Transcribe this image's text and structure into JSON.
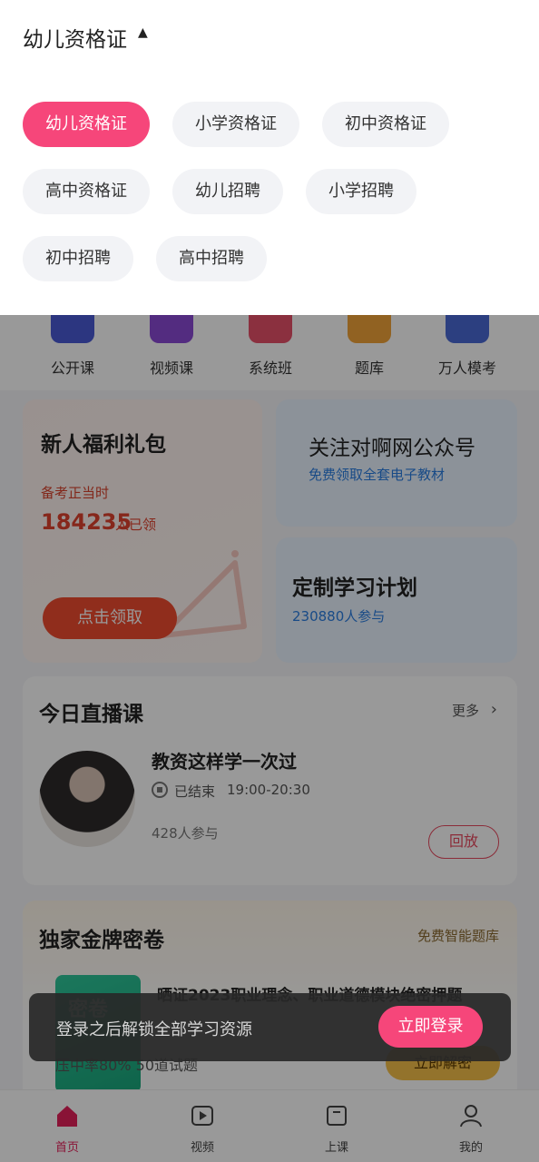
{
  "quick_nav": [
    {
      "label": "公开课",
      "icon": "open-class-icon",
      "color": "#4a5bd6"
    },
    {
      "label": "视频课",
      "icon": "video-class-icon",
      "color": "#8a4ad6"
    },
    {
      "label": "系统班",
      "icon": "system-class-icon",
      "color": "#e8506a"
    },
    {
      "label": "题库",
      "icon": "question-bank-icon",
      "color": "#f2a33a"
    },
    {
      "label": "万人模考",
      "icon": "mock-exam-icon",
      "color": "#4a6ad6"
    }
  ],
  "gift_card": {
    "title": "新人福利礼包",
    "subtitle": "备考正当时",
    "count": "184235",
    "count_unit": "人已领",
    "button": "点击领取"
  },
  "follow_card": {
    "title": "关注对啊网公众号",
    "subtitle": "免费领取全套电子教材"
  },
  "plan_card": {
    "title": "定制学习计划",
    "subtitle": "230880人参与"
  },
  "live": {
    "heading": "今日直播课",
    "more": "更多",
    "course_title": "教资这样学一次过",
    "status": "已结束",
    "time": "19:00-20:30",
    "participants": "428人参与",
    "replay": "回放"
  },
  "paper": {
    "heading": "独家金牌密卷",
    "link": "免费智能题库",
    "book_label": "密卷",
    "title": "晒证2023职业理念、职业道德模块绝密押题",
    "subtitle": "压中率80% 50道试题",
    "unlock": "立即解密"
  },
  "tabbar": [
    {
      "label": "首页",
      "icon": "home-icon",
      "active": true
    },
    {
      "label": "视频",
      "icon": "video-play-icon",
      "active": false
    },
    {
      "label": "上课",
      "icon": "class-icon",
      "active": false
    },
    {
      "label": "我的",
      "icon": "profile-icon",
      "active": false
    }
  ],
  "dropdown": {
    "title": "幼儿资格证",
    "options": [
      "幼儿资格证",
      "小学资格证",
      "初中资格证",
      "高中资格证",
      "幼儿招聘",
      "小学招聘",
      "初中招聘",
      "高中招聘"
    ],
    "selected": "幼儿资格证"
  },
  "toast": {
    "text": "登录之后解锁全部学习资源",
    "button": "立即登录"
  },
  "colors": {
    "accent": "#f6467a",
    "link_blue": "#2a7de1"
  }
}
